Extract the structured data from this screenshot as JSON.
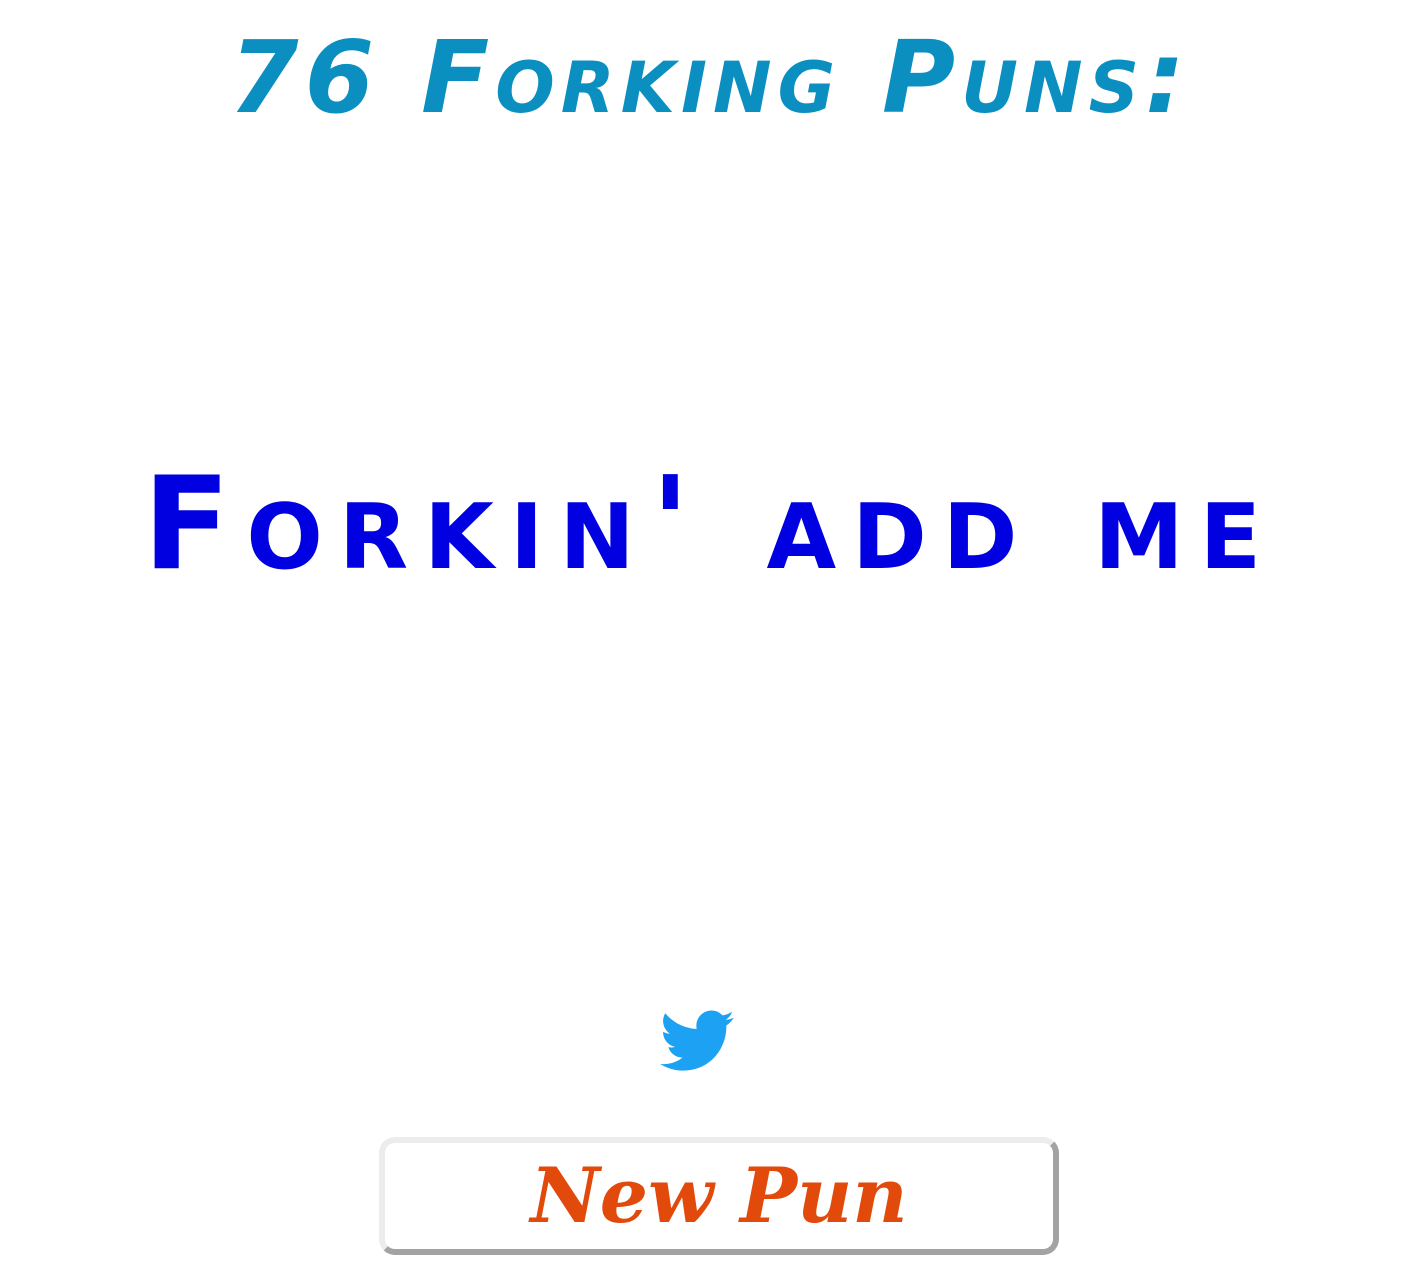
{
  "header": {
    "title": "76 Forking Puns:"
  },
  "main": {
    "pun_text": "Forkin' add me"
  },
  "actions": {
    "tweet_icon": "twitter-bird-icon",
    "new_pun_label": "New Pun"
  },
  "colors": {
    "title": "#0a8fc0",
    "pun": "#0000e0",
    "twitter": "#1da1f2",
    "button_text": "#e24a0c"
  }
}
